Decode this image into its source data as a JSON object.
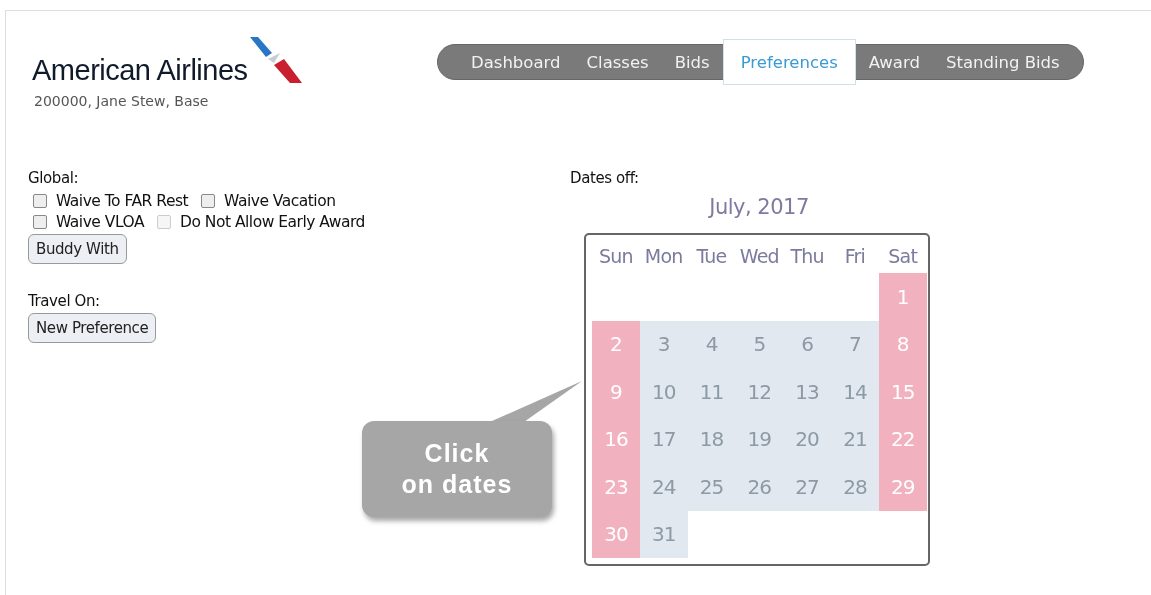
{
  "header": {
    "logo_text": "American Airlines",
    "user_line": "200000, Jane Stew, Base"
  },
  "nav": [
    {
      "label": "Dashboard",
      "selected": false
    },
    {
      "label": "Classes",
      "selected": false
    },
    {
      "label": "Bids",
      "selected": false
    },
    {
      "label": "Preferences",
      "selected": true
    },
    {
      "label": "Award",
      "selected": false
    },
    {
      "label": "Standing Bids",
      "selected": false
    }
  ],
  "global": {
    "heading": "Global:",
    "options": [
      {
        "label": "Waive To FAR Rest",
        "checked": false,
        "disabled": false
      },
      {
        "label": "Waive Vacation",
        "checked": false,
        "disabled": false
      },
      {
        "label": "Waive VLOA",
        "checked": false,
        "disabled": false
      },
      {
        "label": "Do Not Allow Early Award",
        "checked": false,
        "disabled": true
      }
    ],
    "button": "Buddy With"
  },
  "travel_on": {
    "heading": "Travel On:",
    "button": "New Preference"
  },
  "dates_off": {
    "heading": "Dates off:",
    "month": "July, 2017",
    "weekdays": [
      "Sun",
      "Mon",
      "Tue",
      "Wed",
      "Thu",
      "Fri",
      "Sat"
    ],
    "weeks": [
      [
        {
          "kind": "blank"
        },
        {
          "kind": "blank"
        },
        {
          "kind": "blank"
        },
        {
          "kind": "blank"
        },
        {
          "kind": "blank"
        },
        {
          "kind": "blank"
        },
        {
          "kind": "date",
          "day": "1",
          "weekend": true
        }
      ],
      [
        {
          "day": "2",
          "weekend": true
        },
        {
          "day": "3",
          "weekend": false
        },
        {
          "day": "4",
          "weekend": false
        },
        {
          "day": "5",
          "weekend": false
        },
        {
          "day": "6",
          "weekend": false
        },
        {
          "day": "7",
          "weekend": false
        },
        {
          "day": "8",
          "weekend": true
        }
      ],
      [
        {
          "day": "9",
          "weekend": true
        },
        {
          "day": "10",
          "weekend": false
        },
        {
          "day": "11",
          "weekend": false
        },
        {
          "day": "12",
          "weekend": false
        },
        {
          "day": "13",
          "weekend": false
        },
        {
          "day": "14",
          "weekend": false
        },
        {
          "day": "15",
          "weekend": true
        }
      ],
      [
        {
          "day": "16",
          "weekend": true
        },
        {
          "day": "17",
          "weekend": false
        },
        {
          "day": "18",
          "weekend": false
        },
        {
          "day": "19",
          "weekend": false
        },
        {
          "day": "20",
          "weekend": false
        },
        {
          "day": "21",
          "weekend": false
        },
        {
          "day": "22",
          "weekend": true
        }
      ],
      [
        {
          "day": "23",
          "weekend": true
        },
        {
          "day": "24",
          "weekend": false
        },
        {
          "day": "25",
          "weekend": false
        },
        {
          "day": "26",
          "weekend": false
        },
        {
          "day": "27",
          "weekend": false
        },
        {
          "day": "28",
          "weekend": false
        },
        {
          "day": "29",
          "weekend": true
        }
      ],
      [
        {
          "kind": "date",
          "day": "30",
          "weekend": true
        },
        {
          "kind": "date",
          "day": "31",
          "weekend": false
        },
        {
          "kind": "blank"
        },
        {
          "kind": "blank"
        },
        {
          "kind": "blank"
        },
        {
          "kind": "blank"
        },
        {
          "kind": "blank"
        }
      ]
    ]
  },
  "callout": {
    "text": "Click\non dates"
  }
}
